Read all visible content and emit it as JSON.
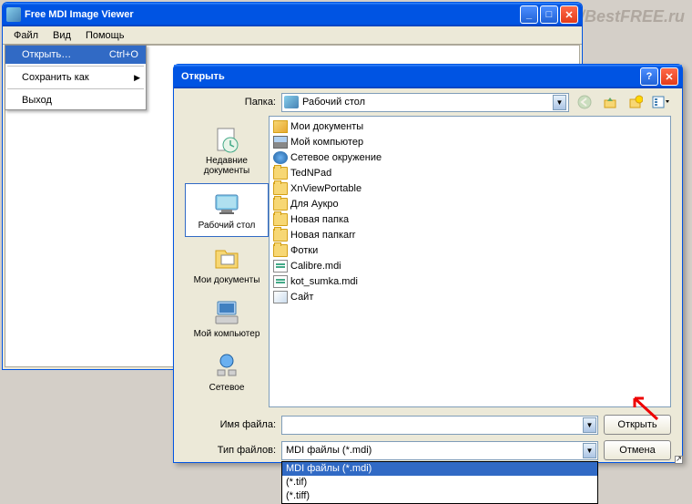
{
  "watermark": "http://BestFREE.ru",
  "main_window": {
    "title": "Free MDI Image Viewer",
    "menu": {
      "file": "Файл",
      "view": "Вид",
      "help": "Помощь"
    },
    "file_menu": {
      "open": "Открыть…",
      "open_shortcut": "Ctrl+O",
      "save_as": "Сохранить как",
      "exit": "Выход"
    }
  },
  "dialog": {
    "title": "Открыть",
    "folder_label": "Папка:",
    "folder_value": "Рабочий стол",
    "places": {
      "recent": "Недавние документы",
      "desktop": "Рабочий стол",
      "mydocs": "Мои документы",
      "mycomp": "Мой компьютер",
      "network": "Сетевое"
    },
    "files": [
      {
        "icon": "mydocs",
        "name": "Мои документы"
      },
      {
        "icon": "mycomp",
        "name": "Мой компьютер"
      },
      {
        "icon": "network",
        "name": "Сетевое окружение"
      },
      {
        "icon": "folder",
        "name": "TedNPad"
      },
      {
        "icon": "folder",
        "name": "XnViewPortable"
      },
      {
        "icon": "folder",
        "name": "Для Аукро"
      },
      {
        "icon": "folder",
        "name": "Новая папка"
      },
      {
        "icon": "folder",
        "name": "Новая папкаrr"
      },
      {
        "icon": "folder",
        "name": "Фотки"
      },
      {
        "icon": "mdi",
        "name": "Calibre.mdi"
      },
      {
        "icon": "mdi",
        "name": "kot_sumka.mdi"
      },
      {
        "icon": "link",
        "name": "Сайт"
      }
    ],
    "filename_label": "Имя файла:",
    "filename_value": "",
    "filetype_label": "Тип файлов:",
    "filetype_value": "MDI файлы (*.mdi)",
    "filetype_options": [
      "MDI файлы (*.mdi)",
      "(*.tif)",
      "(*.tiff)"
    ],
    "open_btn": "Открыть",
    "cancel_btn": "Отмена"
  }
}
